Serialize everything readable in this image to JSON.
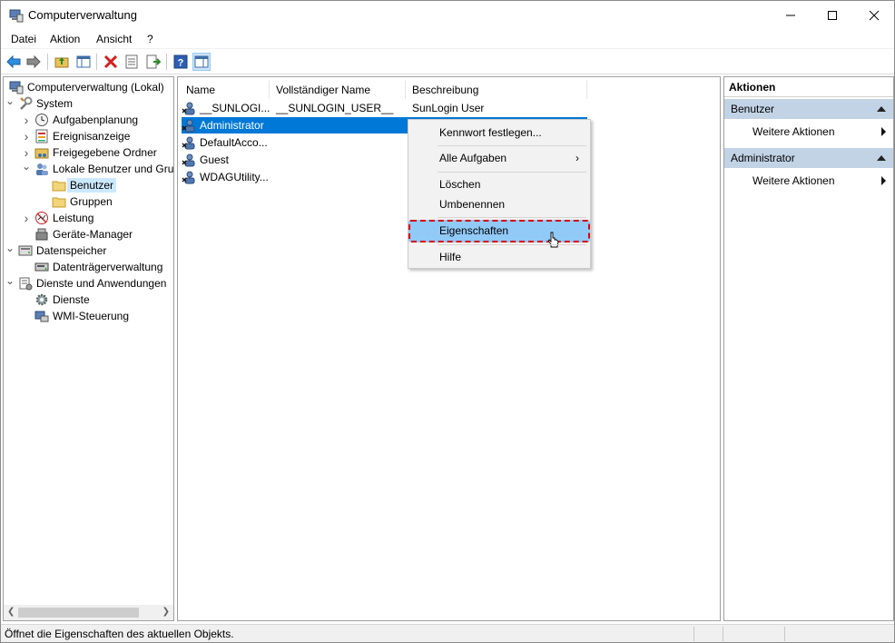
{
  "window": {
    "title": "Computerverwaltung"
  },
  "menubar": [
    "Datei",
    "Aktion",
    "Ansicht",
    "?"
  ],
  "tree": [
    {
      "label": "Computerverwaltung (Lokal)",
      "icon": "computer-management-icon",
      "expander": ""
    },
    {
      "label": "System",
      "icon": "tools-icon",
      "expander": "expanded"
    },
    {
      "label": "Aufgabenplanung",
      "icon": "clock-icon",
      "expander": "collapsed"
    },
    {
      "label": "Ereignisanzeige",
      "icon": "event-viewer-icon",
      "expander": "collapsed"
    },
    {
      "label": "Freigegebene Ordner",
      "icon": "shared-folder-icon",
      "expander": "collapsed"
    },
    {
      "label": "Lokale Benutzer und Gruppen",
      "icon": "users-icon",
      "expander": "expanded"
    },
    {
      "label": "Benutzer",
      "icon": "folder-icon",
      "expander": ""
    },
    {
      "label": "Gruppen",
      "icon": "folder-icon",
      "expander": ""
    },
    {
      "label": "Leistung",
      "icon": "performance-icon",
      "expander": "collapsed"
    },
    {
      "label": "Geräte-Manager",
      "icon": "device-manager-icon",
      "expander": ""
    },
    {
      "label": "Datenspeicher",
      "icon": "storage-icon",
      "expander": "expanded"
    },
    {
      "label": "Datenträgerverwaltung",
      "icon": "disk-icon",
      "expander": ""
    },
    {
      "label": "Dienste und Anwendungen",
      "icon": "services-apps-icon",
      "expander": "expanded"
    },
    {
      "label": "Dienste",
      "icon": "gear-icon",
      "expander": ""
    },
    {
      "label": "WMI-Steuerung",
      "icon": "wmi-icon",
      "expander": ""
    }
  ],
  "list": {
    "columns": [
      "Name",
      "Vollständiger Name",
      "Beschreibung"
    ],
    "rows": [
      {
        "name": "__SUNLOGI...",
        "fullname": "__SUNLOGIN_USER__",
        "description": "SunLogin User"
      },
      {
        "name": "Administrator",
        "fullname": "",
        "description": ""
      },
      {
        "name": "DefaultAcco...",
        "fullname": "",
        "description": ""
      },
      {
        "name": "Guest",
        "fullname": "",
        "description": ""
      },
      {
        "name": "WDAGUtility...",
        "fullname": "",
        "description": ""
      }
    ]
  },
  "context_menu": {
    "set_password": "Kennwort festlegen...",
    "all_tasks": "Alle Aufgaben",
    "delete": "Löschen",
    "rename": "Umbenennen",
    "properties": "Eigenschaften",
    "help": "Hilfe"
  },
  "actions": {
    "title": "Aktionen",
    "section1": "Benutzer",
    "section1_item": "Weitere Aktionen",
    "section2": "Administrator",
    "section2_item": "Weitere Aktionen"
  },
  "status": "Öffnet die Eigenschaften des aktuellen Objekts.",
  "colors": {
    "selection": "#0078d7",
    "highlight": "#91c9f7",
    "dashed_border": "#d9000a",
    "action_header": "#c2d3e6"
  }
}
